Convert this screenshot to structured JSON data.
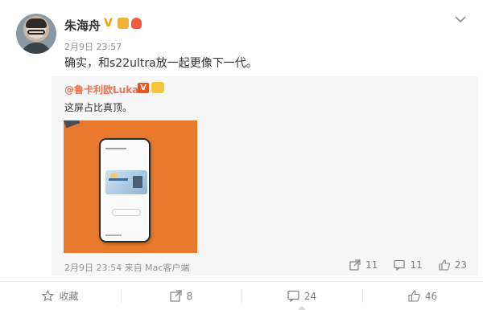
{
  "post": {
    "author": "朱海舟",
    "timestamp": "2月9日 23:57",
    "text": "确实，和s22ultra放一起更像下一代。",
    "colors": {
      "verified": "#f6a300",
      "accent": "#eb7350"
    }
  },
  "retweet": {
    "author": "@鲁卡利欧Luka",
    "verified_label": "V",
    "text": "这屏占比真顶。",
    "meta": "2月9日 23:54 来自 Mac客户端",
    "actions": {
      "forward_count": "11",
      "comment_count": "11",
      "like_count": "23"
    }
  },
  "bottom_bar": {
    "favorite_label": "收藏",
    "forward_count": "8",
    "comment_count": "24",
    "like_count": "46"
  },
  "icons": [
    "chevron-down-icon",
    "forward-icon",
    "comment-icon",
    "like-icon",
    "favorite-icon"
  ]
}
